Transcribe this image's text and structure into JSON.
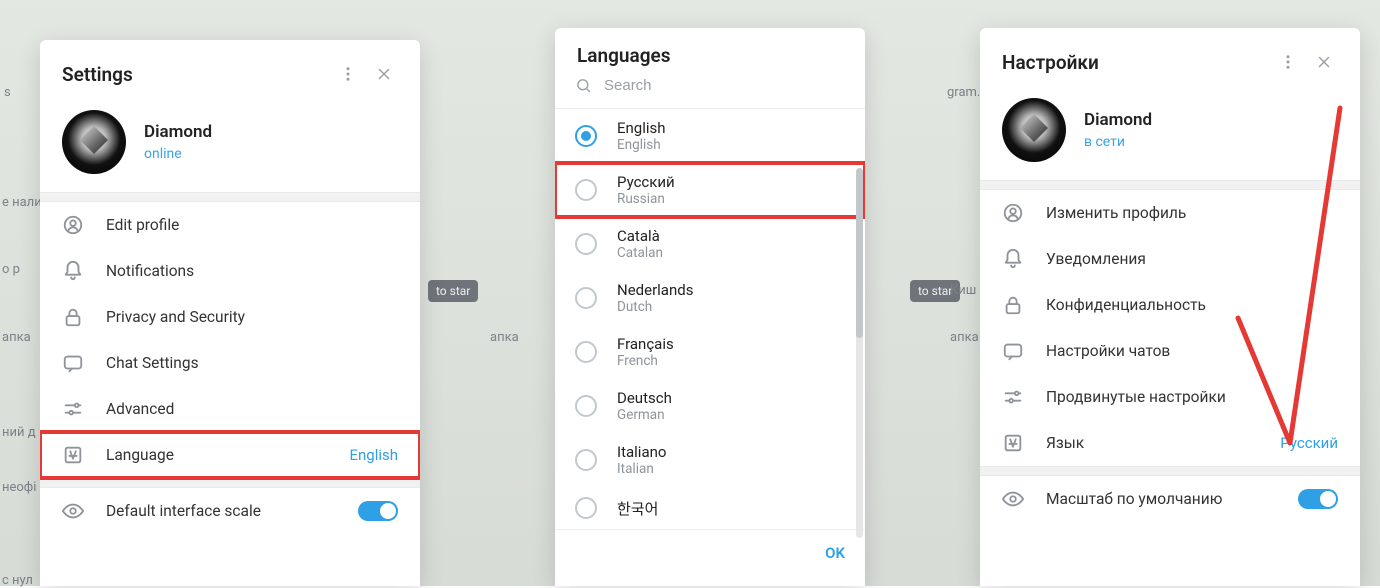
{
  "panel1": {
    "title": "Settings",
    "user": {
      "name": "Diamond",
      "status": "online"
    },
    "items": [
      {
        "icon": "user-icon",
        "label": "Edit profile",
        "value": ""
      },
      {
        "icon": "bell-icon",
        "label": "Notifications",
        "value": ""
      },
      {
        "icon": "lock-icon",
        "label": "Privacy and Security",
        "value": ""
      },
      {
        "icon": "chat-icon",
        "label": "Chat Settings",
        "value": ""
      },
      {
        "icon": "sliders-icon",
        "label": "Advanced",
        "value": ""
      },
      {
        "icon": "lang-icon",
        "label": "Language",
        "value": "English",
        "hl": true
      }
    ],
    "scale_label": "Default interface scale"
  },
  "panel2": {
    "title": "Languages",
    "search_placeholder": "Search",
    "options": [
      {
        "name": "English",
        "sub": "English",
        "selected": true
      },
      {
        "name": "Русский",
        "sub": "Russian",
        "selected": false,
        "hl": true
      },
      {
        "name": "Català",
        "sub": "Catalan",
        "selected": false
      },
      {
        "name": "Nederlands",
        "sub": "Dutch",
        "selected": false
      },
      {
        "name": "Français",
        "sub": "French",
        "selected": false
      },
      {
        "name": "Deutsch",
        "sub": "German",
        "selected": false
      },
      {
        "name": "Italiano",
        "sub": "Italian",
        "selected": false
      },
      {
        "name": "한국어",
        "sub": "",
        "selected": false
      }
    ],
    "ok": "OK"
  },
  "panel3": {
    "title": "Настройки",
    "user": {
      "name": "Diamond",
      "status": "в сети"
    },
    "items": [
      {
        "icon": "user-icon",
        "label": "Изменить профиль",
        "value": ""
      },
      {
        "icon": "bell-icon",
        "label": "Уведомления",
        "value": ""
      },
      {
        "icon": "lock-icon",
        "label": "Конфиденциальность",
        "value": ""
      },
      {
        "icon": "chat-icon",
        "label": "Настройки чатов",
        "value": ""
      },
      {
        "icon": "sliders-icon",
        "label": "Продвинутые настройки",
        "value": ""
      },
      {
        "icon": "lang-icon",
        "label": "Язык",
        "value": "Русский"
      }
    ],
    "scale_label": "Масштаб по умолчанию"
  },
  "bg": {
    "to_start": "to star",
    "papka": "апка",
    "s": "s",
    "op": "о р",
    "nij": "ний д",
    "neof": "неофі",
    "c_nul": "с нул",
    "nalych": "е налич",
    "kysh": "Киш",
    "gram": "gram.m"
  }
}
